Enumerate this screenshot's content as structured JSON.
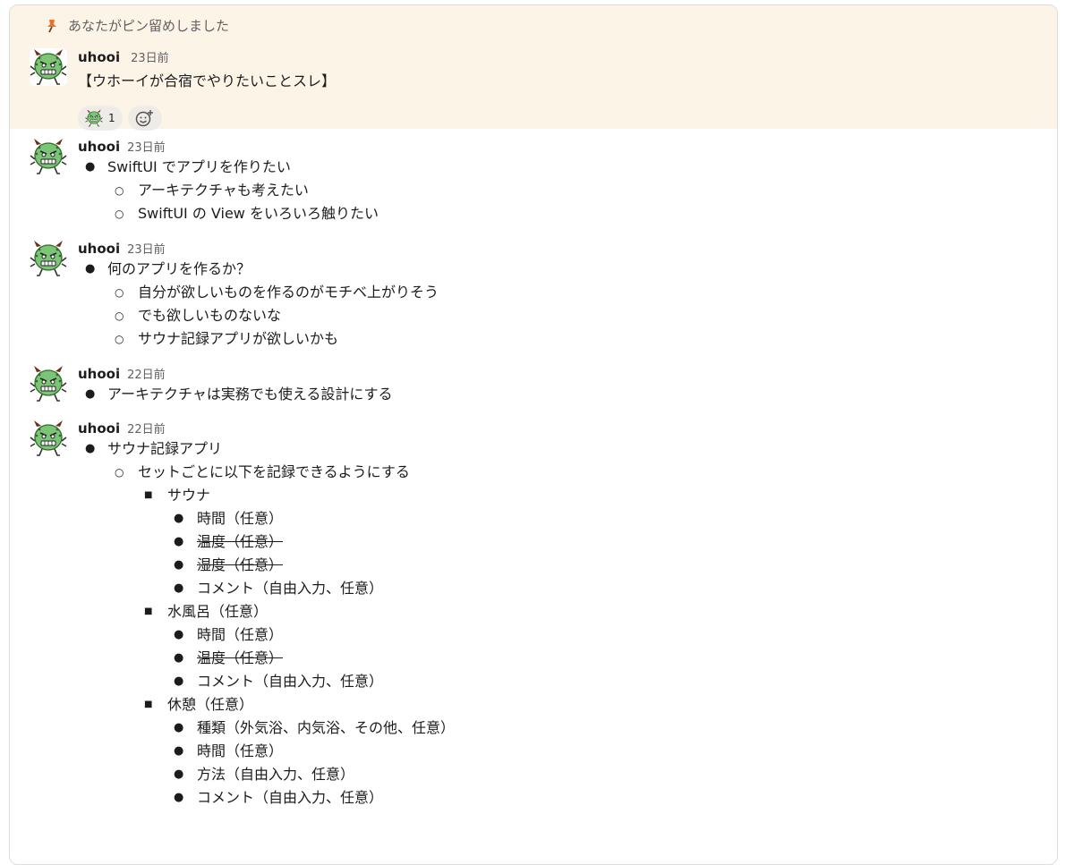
{
  "pinned": {
    "label": "あなたがピン留めしました",
    "message": {
      "author": "uhooi",
      "time": "23日前",
      "text": "【ウホーイが合宿でやりたいことスレ】",
      "reaction_count": "1"
    }
  },
  "messages": [
    {
      "author": "uhooi",
      "time": "23日前",
      "items": [
        {
          "level": 1,
          "text": "SwiftUI でアプリを作りたい",
          "strike": false
        },
        {
          "level": 2,
          "text": "アーキテクチャも考えたい",
          "strike": false
        },
        {
          "level": 2,
          "text": "SwiftUI の View をいろいろ触りたい",
          "strike": false
        }
      ]
    },
    {
      "author": "uhooi",
      "time": "23日前",
      "items": [
        {
          "level": 1,
          "text": "何のアプリを作るか？",
          "strike": false
        },
        {
          "level": 2,
          "text": "自分が欲しいものを作るのがモチベ上がりそう",
          "strike": false
        },
        {
          "level": 2,
          "text": "でも欲しいものないな",
          "strike": false
        },
        {
          "level": 2,
          "text": "サウナ記録アプリが欲しいかも",
          "strike": false
        }
      ]
    },
    {
      "author": "uhooi",
      "time": "22日前",
      "items": [
        {
          "level": 1,
          "text": "アーキテクチャは実務でも使える設計にする",
          "strike": false
        }
      ]
    },
    {
      "author": "uhooi",
      "time": "22日前",
      "items": [
        {
          "level": 1,
          "text": "サウナ記録アプリ",
          "strike": false
        },
        {
          "level": 2,
          "text": "セットごとに以下を記録できるようにする",
          "strike": false
        },
        {
          "level": 3,
          "text": "サウナ",
          "strike": false
        },
        {
          "level": 4,
          "text": "時間（任意）",
          "strike": false
        },
        {
          "level": 4,
          "text": "温度（任意）",
          "strike": true
        },
        {
          "level": 4,
          "text": "湿度（任意）",
          "strike": true
        },
        {
          "level": 4,
          "text": "コメント（自由入力、任意）",
          "strike": false
        },
        {
          "level": 3,
          "text": "水風呂（任意）",
          "strike": false
        },
        {
          "level": 4,
          "text": "時間（任意）",
          "strike": false
        },
        {
          "level": 4,
          "text": "温度（任意）",
          "strike": true
        },
        {
          "level": 4,
          "text": "コメント（自由入力、任意）",
          "strike": false
        },
        {
          "level": 3,
          "text": "休憩（任意）",
          "strike": false
        },
        {
          "level": 4,
          "text": "種類（外気浴、内気浴、その他、任意）",
          "strike": false
        },
        {
          "level": 4,
          "text": "時間（任意）",
          "strike": false
        },
        {
          "level": 4,
          "text": "方法（自由入力、任意）",
          "strike": false
        },
        {
          "level": 4,
          "text": "コメント（自由入力、任意）",
          "strike": false
        }
      ]
    }
  ],
  "icons": {
    "pin": "pushpin-icon",
    "avatar": "green-monster-avatar",
    "add_reaction": "add-reaction-icon"
  },
  "colors": {
    "pinned_bg": "#fcf4e6",
    "avatar_green": "#7cc576"
  },
  "bullets": {
    "1": "●",
    "2": "○",
    "3": "■",
    "4": "●"
  }
}
